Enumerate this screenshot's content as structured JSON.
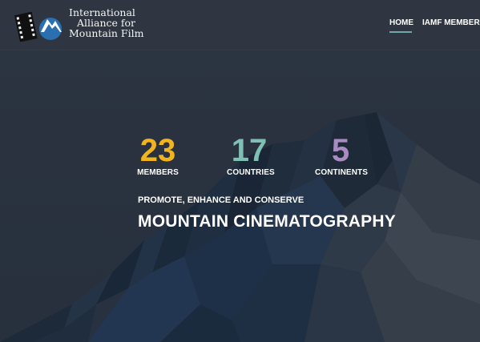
{
  "header": {
    "logo_lines": [
      "International",
      "Alliance for",
      "Mountain Film"
    ],
    "nav": [
      {
        "label": "HOME",
        "active": true
      },
      {
        "label": "IAMF MEMBERS",
        "active": false
      }
    ]
  },
  "hero": {
    "stats": [
      {
        "value": "23",
        "label": "MEMBERS",
        "color": "#f2b41e"
      },
      {
        "value": "17",
        "label": "COUNTRIES",
        "color": "#7fbfb4"
      },
      {
        "value": "5",
        "label": "CONTINENTS",
        "color": "#a98bc4"
      }
    ],
    "tagline": "PROMOTE, ENHANCE AND CONSERVE",
    "headline": "MOUNTAIN CINEMATOGRAPHY"
  },
  "colors": {
    "accent": "#6fa6a8",
    "header_bg": "#2f3641",
    "page_bg": "#2b3340"
  },
  "icons": {
    "logo": "film-strip-mountain-icon"
  }
}
